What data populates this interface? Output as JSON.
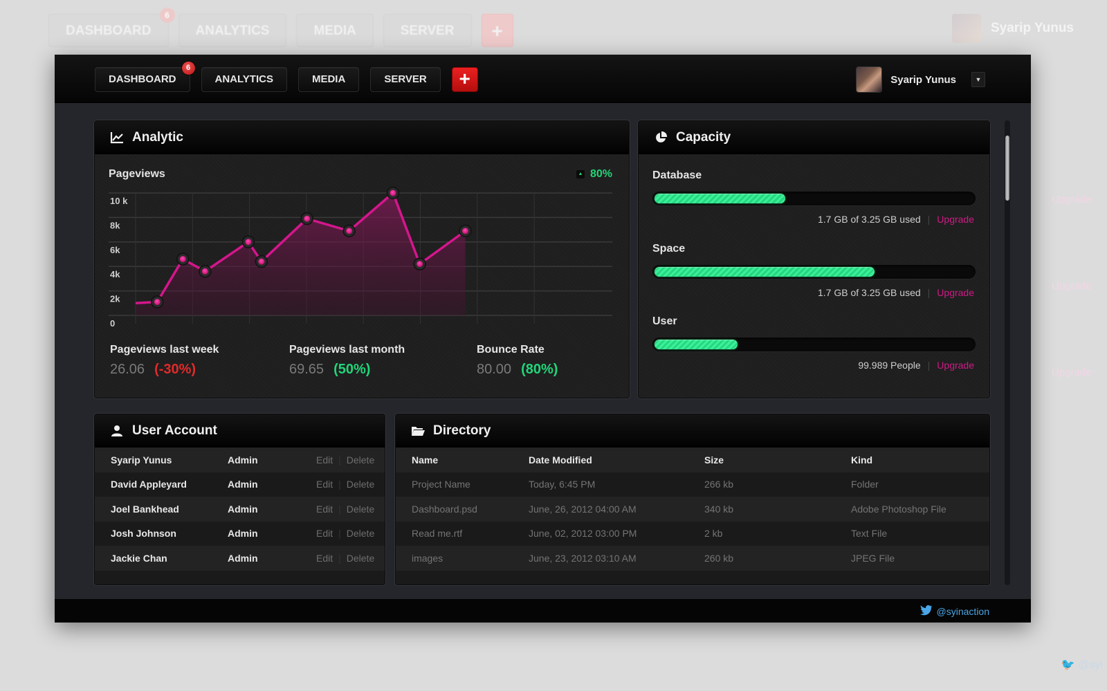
{
  "nav": {
    "items": [
      {
        "label": "DASHBOARD",
        "badge": "6"
      },
      {
        "label": "ANALYTICS"
      },
      {
        "label": "MEDIA"
      },
      {
        "label": "SERVER"
      }
    ],
    "add_label": "+"
  },
  "user": {
    "name": "Syarip Yunus",
    "caret": "▼"
  },
  "analytic": {
    "title": "Analytic",
    "icon": "line-chart-icon",
    "pageviews_label": "Pageviews",
    "pageviews_change": "80%",
    "stats": [
      {
        "label": "Pageviews last week",
        "value": "26.06",
        "change": "(-30%)",
        "trend": "down"
      },
      {
        "label": "Pageviews last month",
        "value": "69.65",
        "change": "(50%)",
        "trend": "up"
      },
      {
        "label": "Bounce Rate",
        "value": "80.00",
        "change": "(80%)",
        "trend": "up"
      }
    ]
  },
  "chart_data": {
    "type": "area",
    "title": "Pageviews",
    "xlabel": "",
    "ylabel": "",
    "ylim": [
      0,
      10000
    ],
    "xlim": [
      0,
      8.5
    ],
    "yticks": [
      0,
      2000,
      4000,
      6000,
      8000,
      10000
    ],
    "ytick_labels": [
      "0",
      "2k",
      "4k",
      "6k",
      "8k",
      "10 k"
    ],
    "grid": true,
    "series": [
      {
        "name": "Pageviews",
        "color": "#d4168c",
        "x": [
          0,
          0.38,
          0.83,
          1.22,
          1.98,
          2.21,
          3.01,
          3.75,
          4.52,
          4.99,
          5.79
        ],
        "y": [
          1000,
          1100,
          4600,
          3600,
          6000,
          4400,
          7900,
          6900,
          10000,
          4200,
          6900
        ],
        "markers": [
          false,
          true,
          true,
          true,
          true,
          true,
          true,
          true,
          true,
          true,
          true
        ]
      }
    ]
  },
  "capacity": {
    "title": "Capacity",
    "icon": "pie-chart-icon",
    "items": [
      {
        "label": "Database",
        "info": "1.7 GB of 3.25 GB used",
        "fraction": 0.41,
        "action": "Upgrade"
      },
      {
        "label": "Space",
        "info": "1.7 GB of 3.25 GB used",
        "fraction": 0.69,
        "action": "Upgrade"
      },
      {
        "label": "User",
        "info": "99.989 People",
        "fraction": 0.26,
        "action": "Upgrade"
      }
    ]
  },
  "user_account": {
    "title": "User Account",
    "icon": "user-icon",
    "edit_label": "Edit",
    "delete_label": "Delete",
    "rows": [
      {
        "name": "Syarip Yunus",
        "role": "Admin"
      },
      {
        "name": "David Appleyard",
        "role": "Admin"
      },
      {
        "name": "Joel Bankhead",
        "role": "Admin"
      },
      {
        "name": "Josh Johnson",
        "role": "Admin"
      },
      {
        "name": "Jackie Chan",
        "role": "Admin"
      }
    ]
  },
  "directory": {
    "title": "Directory",
    "icon": "folder-icon",
    "columns": [
      "Name",
      "Date Modified",
      "Size",
      "Kind"
    ],
    "rows": [
      {
        "name": "Project Name",
        "date": "Today, 6:45 PM",
        "size": "266 kb",
        "kind": "Folder"
      },
      {
        "name": "Dashboard.psd",
        "date": "June, 26, 2012  04:00 AM",
        "size": "340 kb",
        "kind": "Adobe Photoshop File"
      },
      {
        "name": "Read me.rtf",
        "date": "June, 02, 2012  03:00 PM",
        "size": "2 kb",
        "kind": "Text File"
      },
      {
        "name": "images",
        "date": "June, 23, 2012  03:10 AM",
        "size": "260 kb",
        "kind": "JPEG File"
      }
    ]
  },
  "footer": {
    "twitter_handle": "@syinaction"
  },
  "colors": {
    "accent_pink": "#d4168c",
    "positive_green": "#20d67a",
    "negative_red": "#e22a2a",
    "add_button_red": "#e01818"
  }
}
